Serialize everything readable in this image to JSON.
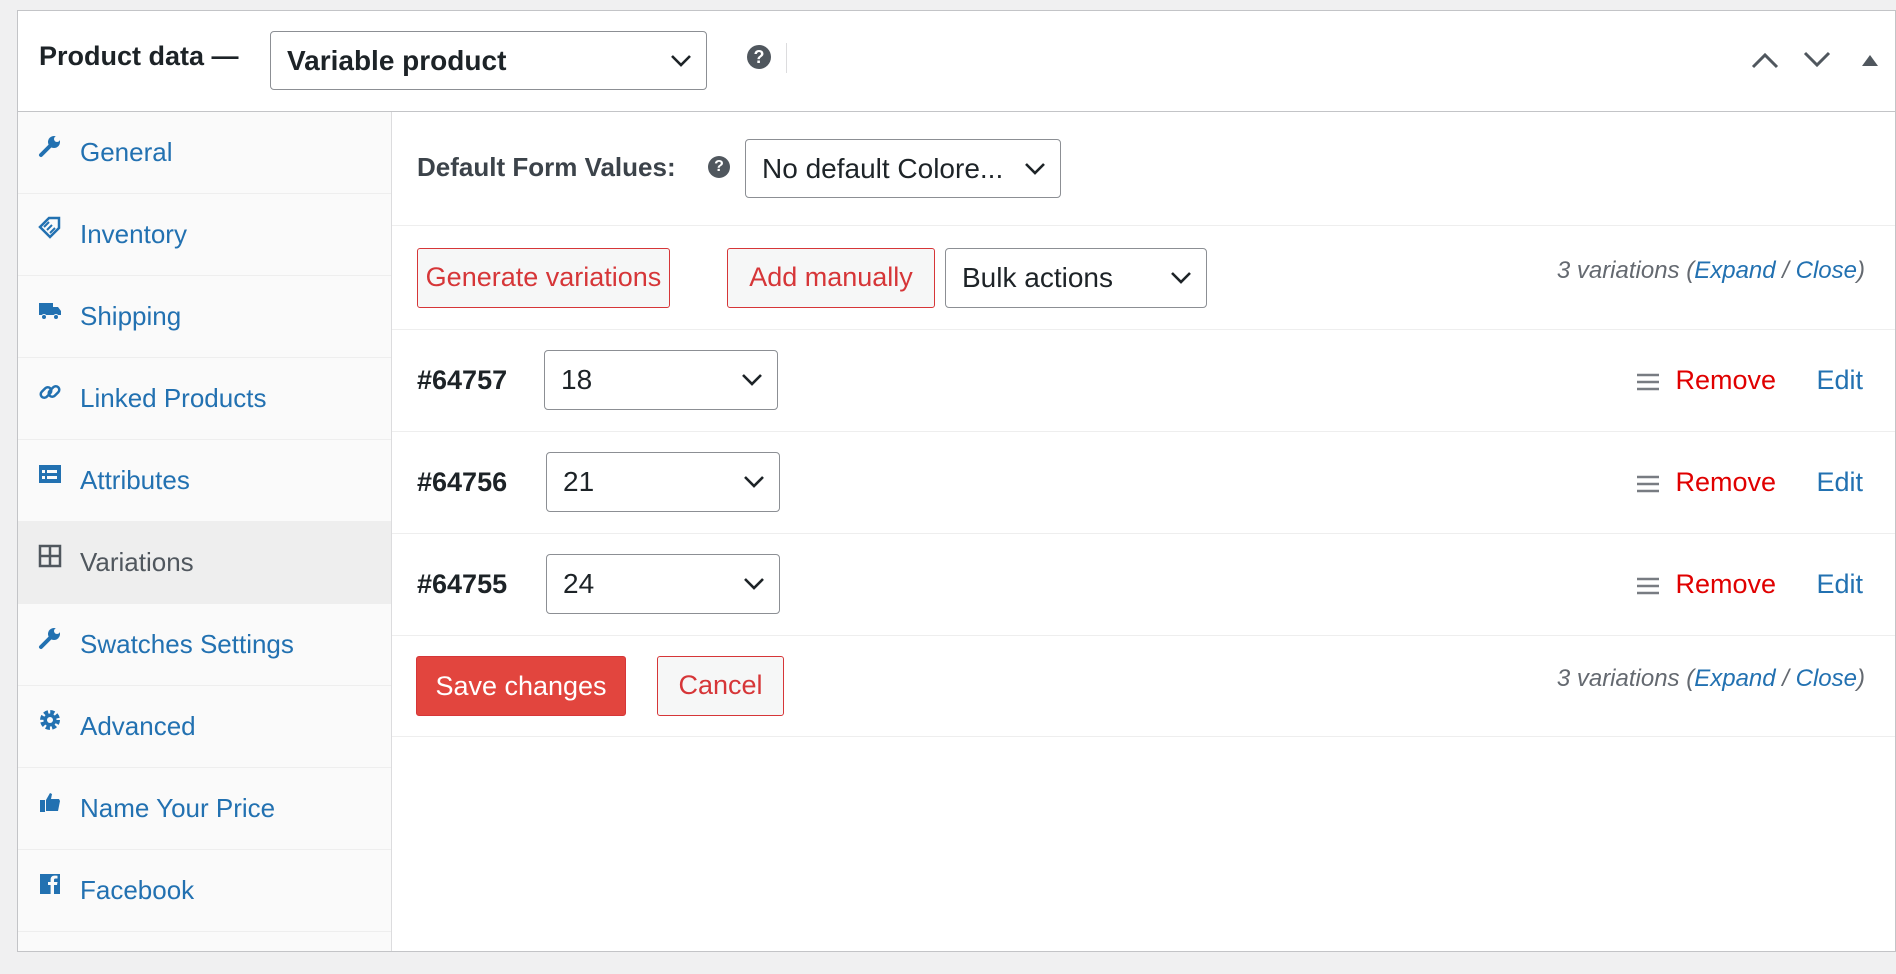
{
  "header": {
    "title": "Product data —",
    "product_type": "Variable product"
  },
  "sidebar": {
    "items": [
      {
        "label": "General",
        "icon": "wrench-icon"
      },
      {
        "label": "Inventory",
        "icon": "tag-icon"
      },
      {
        "label": "Shipping",
        "icon": "truck-icon"
      },
      {
        "label": "Linked Products",
        "icon": "link-icon"
      },
      {
        "label": "Attributes",
        "icon": "list-card-icon"
      },
      {
        "label": "Variations",
        "icon": "grid-icon",
        "active": true
      },
      {
        "label": "Swatches Settings",
        "icon": "wrench-icon"
      },
      {
        "label": "Advanced",
        "icon": "gear-icon"
      },
      {
        "label": "Name Your Price",
        "icon": "thumbs-up-icon"
      },
      {
        "label": "Facebook",
        "icon": "facebook-icon"
      }
    ]
  },
  "default_form": {
    "label": "Default Form Values:",
    "value": "No default Colore..."
  },
  "toolbar": {
    "generate_label": "Generate variations",
    "add_label": "Add manually",
    "bulk_label": "Bulk actions"
  },
  "variation_count": {
    "text": "3 variations (",
    "expand": "Expand",
    "sep": " / ",
    "close": "Close",
    "end": ")"
  },
  "variations": [
    {
      "id": "#64757",
      "value": "18",
      "remove": "Remove",
      "edit": "Edit"
    },
    {
      "id": "#64756",
      "value": "21",
      "remove": "Remove",
      "edit": "Edit"
    },
    {
      "id": "#64755",
      "value": "24",
      "remove": "Remove",
      "edit": "Edit"
    }
  ],
  "footer": {
    "save_label": "Save changes",
    "cancel_label": "Cancel"
  },
  "colors": {
    "link": "#2271b1",
    "danger": "#d63638",
    "remove": "#e00000",
    "save_bg": "#e2453e"
  }
}
